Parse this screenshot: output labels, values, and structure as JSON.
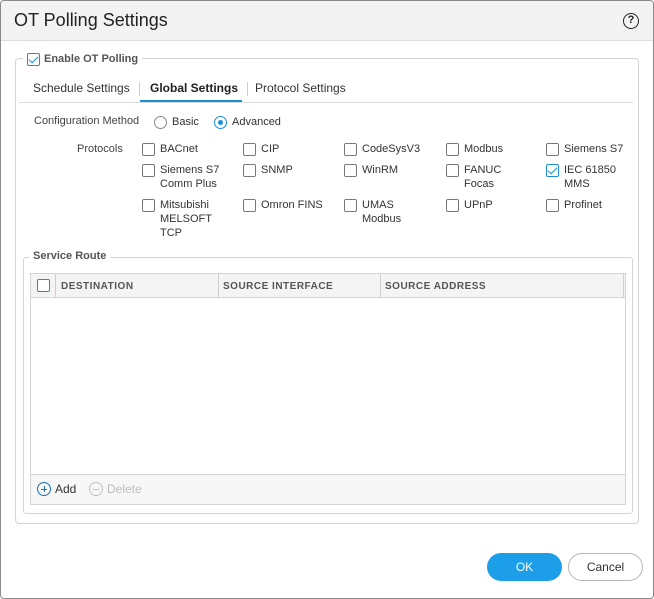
{
  "dialog": {
    "title": "OT Polling Settings",
    "help_icon": "help-icon",
    "help_glyph": "?"
  },
  "enable": {
    "label": "Enable OT Polling",
    "checked": true
  },
  "tabs": [
    {
      "label": "Schedule Settings",
      "active": false
    },
    {
      "label": "Global Settings",
      "active": true
    },
    {
      "label": "Protocol Settings",
      "active": false
    }
  ],
  "config": {
    "label": "Configuration Method",
    "options": [
      {
        "label": "Basic",
        "selected": false
      },
      {
        "label": "Advanced",
        "selected": true
      }
    ]
  },
  "protocols": {
    "label": "Protocols",
    "items": [
      {
        "label": "BACnet",
        "checked": false
      },
      {
        "label": "CIP",
        "checked": false
      },
      {
        "label": "CodeSysV3",
        "checked": false
      },
      {
        "label": "Modbus",
        "checked": false
      },
      {
        "label": "Siemens S7",
        "checked": false
      },
      {
        "label": "Siemens S7\nComm Plus",
        "checked": false
      },
      {
        "label": "SNMP",
        "checked": false
      },
      {
        "label": "WinRM",
        "checked": false
      },
      {
        "label": "FANUC\nFocas",
        "checked": false
      },
      {
        "label": "IEC 61850\nMMS",
        "checked": true
      },
      {
        "label": "Mitsubishi\nMELSOFT\nTCP",
        "checked": false
      },
      {
        "label": "Omron FINS",
        "checked": false
      },
      {
        "label": "UMAS\nModbus",
        "checked": false
      },
      {
        "label": "UPnP",
        "checked": false
      },
      {
        "label": "Profinet",
        "checked": false
      }
    ]
  },
  "service_route": {
    "label": "Service Route",
    "columns": [
      "DESTINATION",
      "SOURCE INTERFACE",
      "SOURCE ADDRESS"
    ],
    "rows": [],
    "add_label": "Add",
    "delete_label": "Delete"
  },
  "footer": {
    "ok_label": "OK",
    "cancel_label": "Cancel"
  },
  "colors": {
    "accent": "#1b8fd6",
    "ok_button": "#1c9ee8"
  }
}
